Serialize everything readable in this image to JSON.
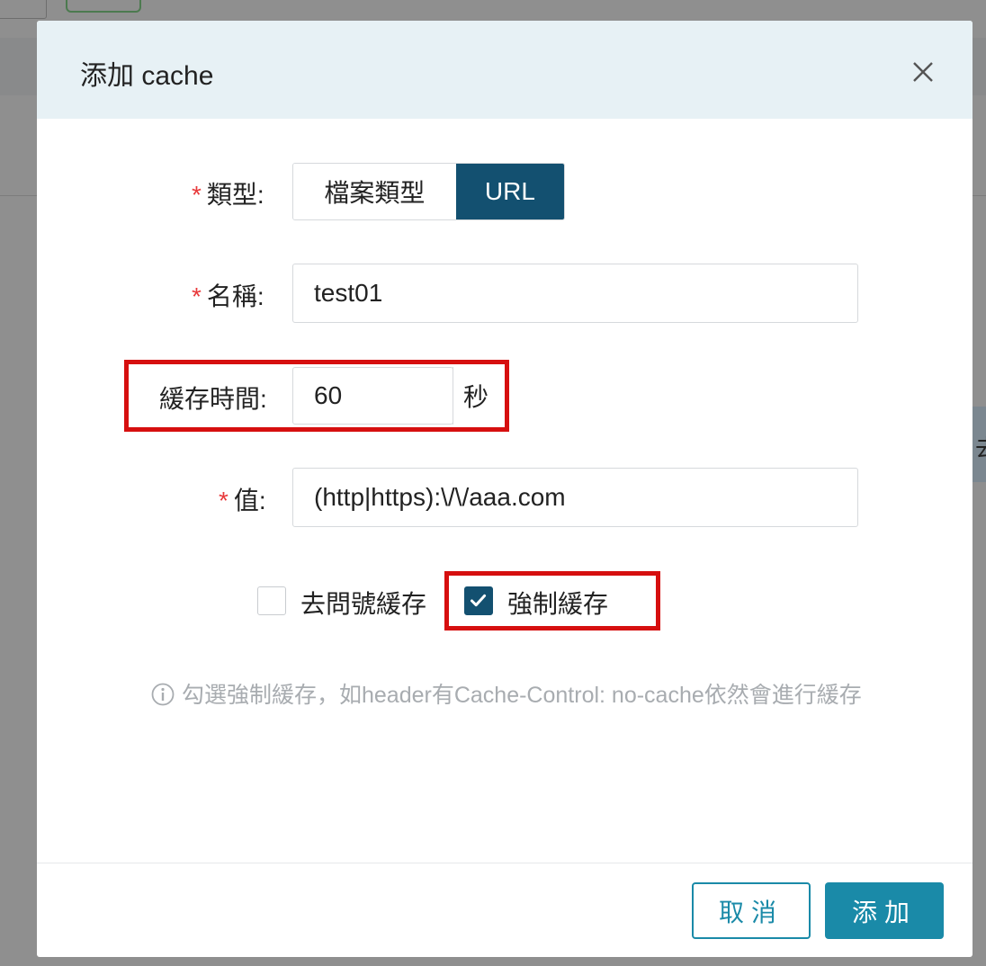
{
  "background": {
    "right_char": "去"
  },
  "modal": {
    "title": "添加 cache",
    "type_label": "類型:",
    "type_options": [
      "檔案類型",
      "URL"
    ],
    "type_selected": "URL",
    "name_label": "名稱:",
    "name_value": "test01",
    "cache_time_label": "緩存時間:",
    "cache_time_value": "60",
    "cache_time_unit": "秒",
    "value_label": "值:",
    "value_value": "(http|https):\\/\\/aaa.com",
    "required_mark": "*",
    "checkbox_query": {
      "label": "去問號緩存",
      "checked": false
    },
    "checkbox_force": {
      "label": "強制緩存",
      "checked": true
    },
    "hint": "勾選強制緩存，如header有Cache-Control: no-cache依然會進行緩存",
    "cancel_label": "取消",
    "add_label": "添加"
  },
  "colors": {
    "primary": "#1a8aa8",
    "selected_dark": "#135070",
    "highlight": "#d60f0f",
    "required": "#e8393b",
    "header_bg": "#e7f1f5"
  },
  "icons": {
    "close": "close-icon",
    "info": "info-icon",
    "check": "check-icon"
  }
}
